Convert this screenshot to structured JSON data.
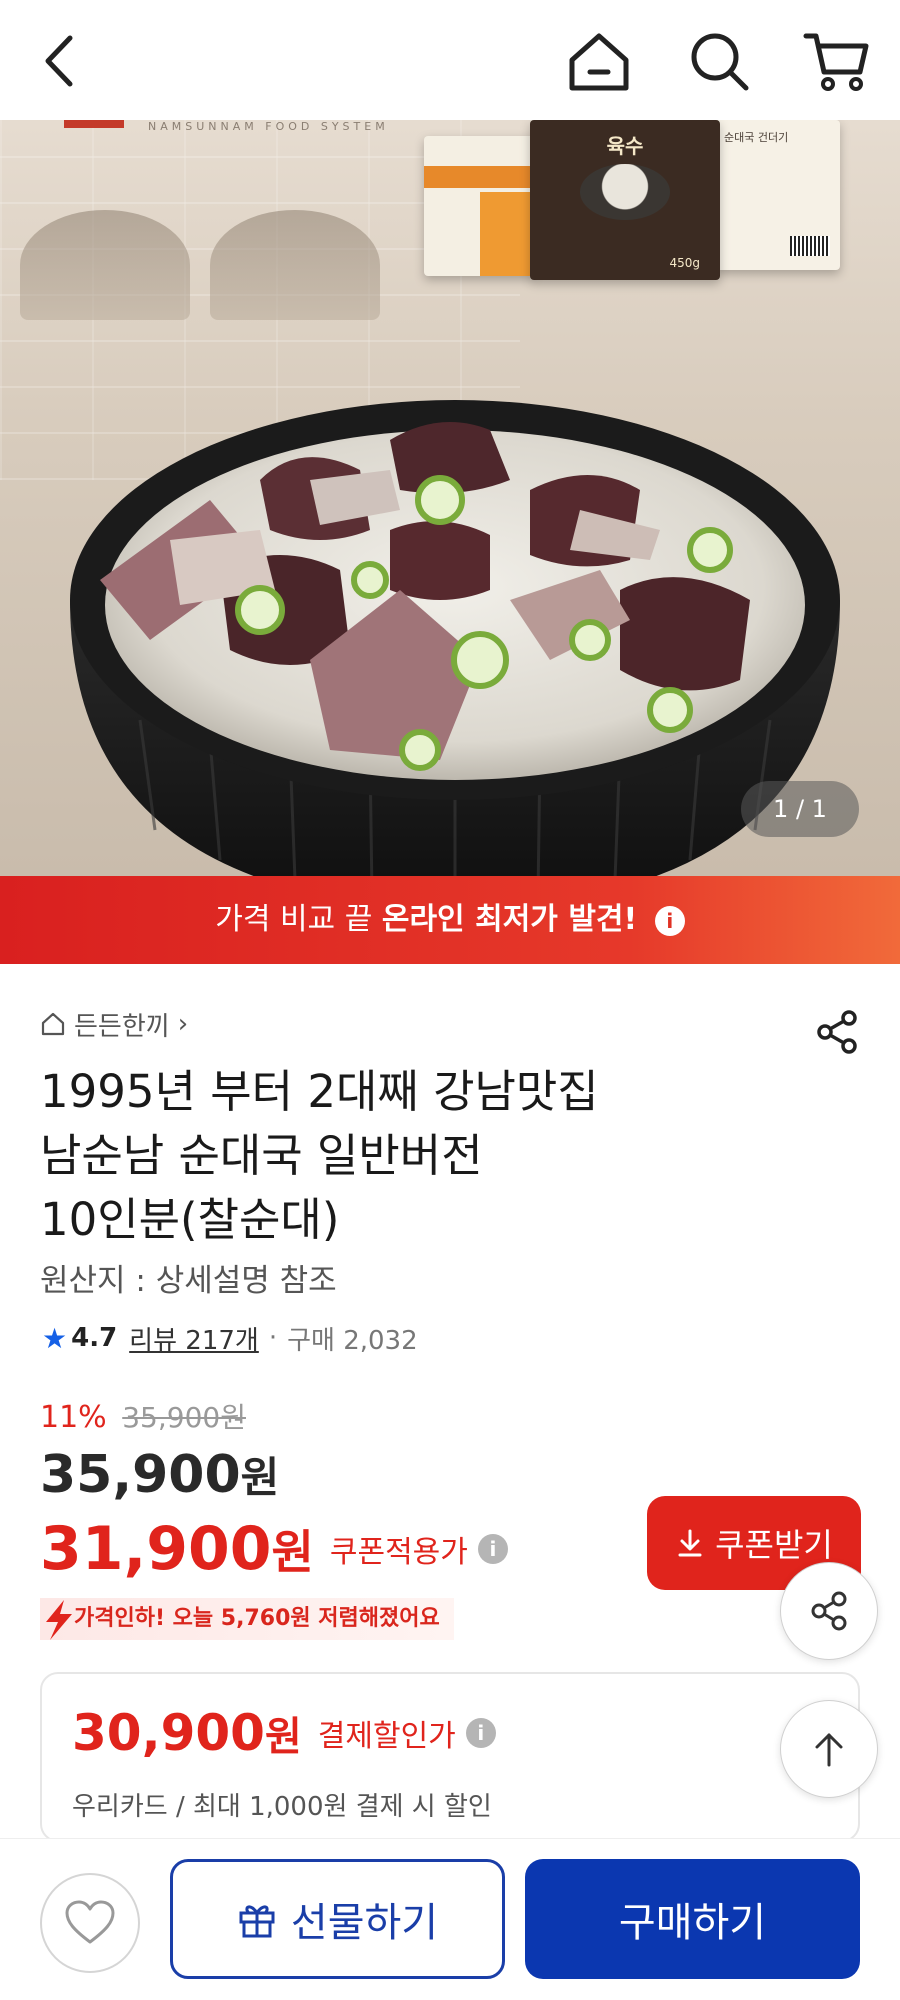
{
  "colors": {
    "accent_red": "#e0241c",
    "brand_blue": "#0b37b0",
    "rating_star": "#1560e6"
  },
  "header": {
    "icons": [
      "back-arrow-icon",
      "home-icon",
      "search-icon",
      "cart-icon"
    ]
  },
  "hero": {
    "brand_line": "NAMSUNNAM FOOD SYSTEM",
    "package_label": "육수",
    "package_weight": "450g",
    "package_side_text": "순대국 건더기",
    "page_indicator": "1 / 1"
  },
  "promo_banner": {
    "prefix": "가격 비교 끝",
    "highlight": "온라인 최저가 발견!",
    "info_glyph": "i"
  },
  "product": {
    "store_name": "든든한끼",
    "store_chevron": "›",
    "title_line1": "1995년 부터 2대째 강남맛집",
    "title_line2": "남순남 순대국 일반버전",
    "title_line3": "10인분(찰순대)",
    "origin": "원산지 : 상세설명 참조",
    "rating_star": "★",
    "rating": "4.7",
    "review_label": "리뷰 217개",
    "separator": "·",
    "purchases": "구매 2,032"
  },
  "pricing": {
    "discount_rate": "11%",
    "original_price": "35,900원",
    "price": "35,900",
    "price_unit": "원",
    "coupon_price": "31,900",
    "coupon_unit": "원",
    "coupon_label": "쿠폰적용가",
    "info_glyph": "i",
    "coupon_button": "쿠폰받기",
    "price_drop_text": "가격인하! 오늘 5,760원 저렴해졌어요"
  },
  "payment": {
    "price": "30,900",
    "unit": "원",
    "label": "결제할인가",
    "info_glyph": "i",
    "description": "우리카드 / 최대 1,000원 결제 시 할인"
  },
  "bottom_bar": {
    "gift_label": "선물하기",
    "buy_label": "구매하기"
  }
}
